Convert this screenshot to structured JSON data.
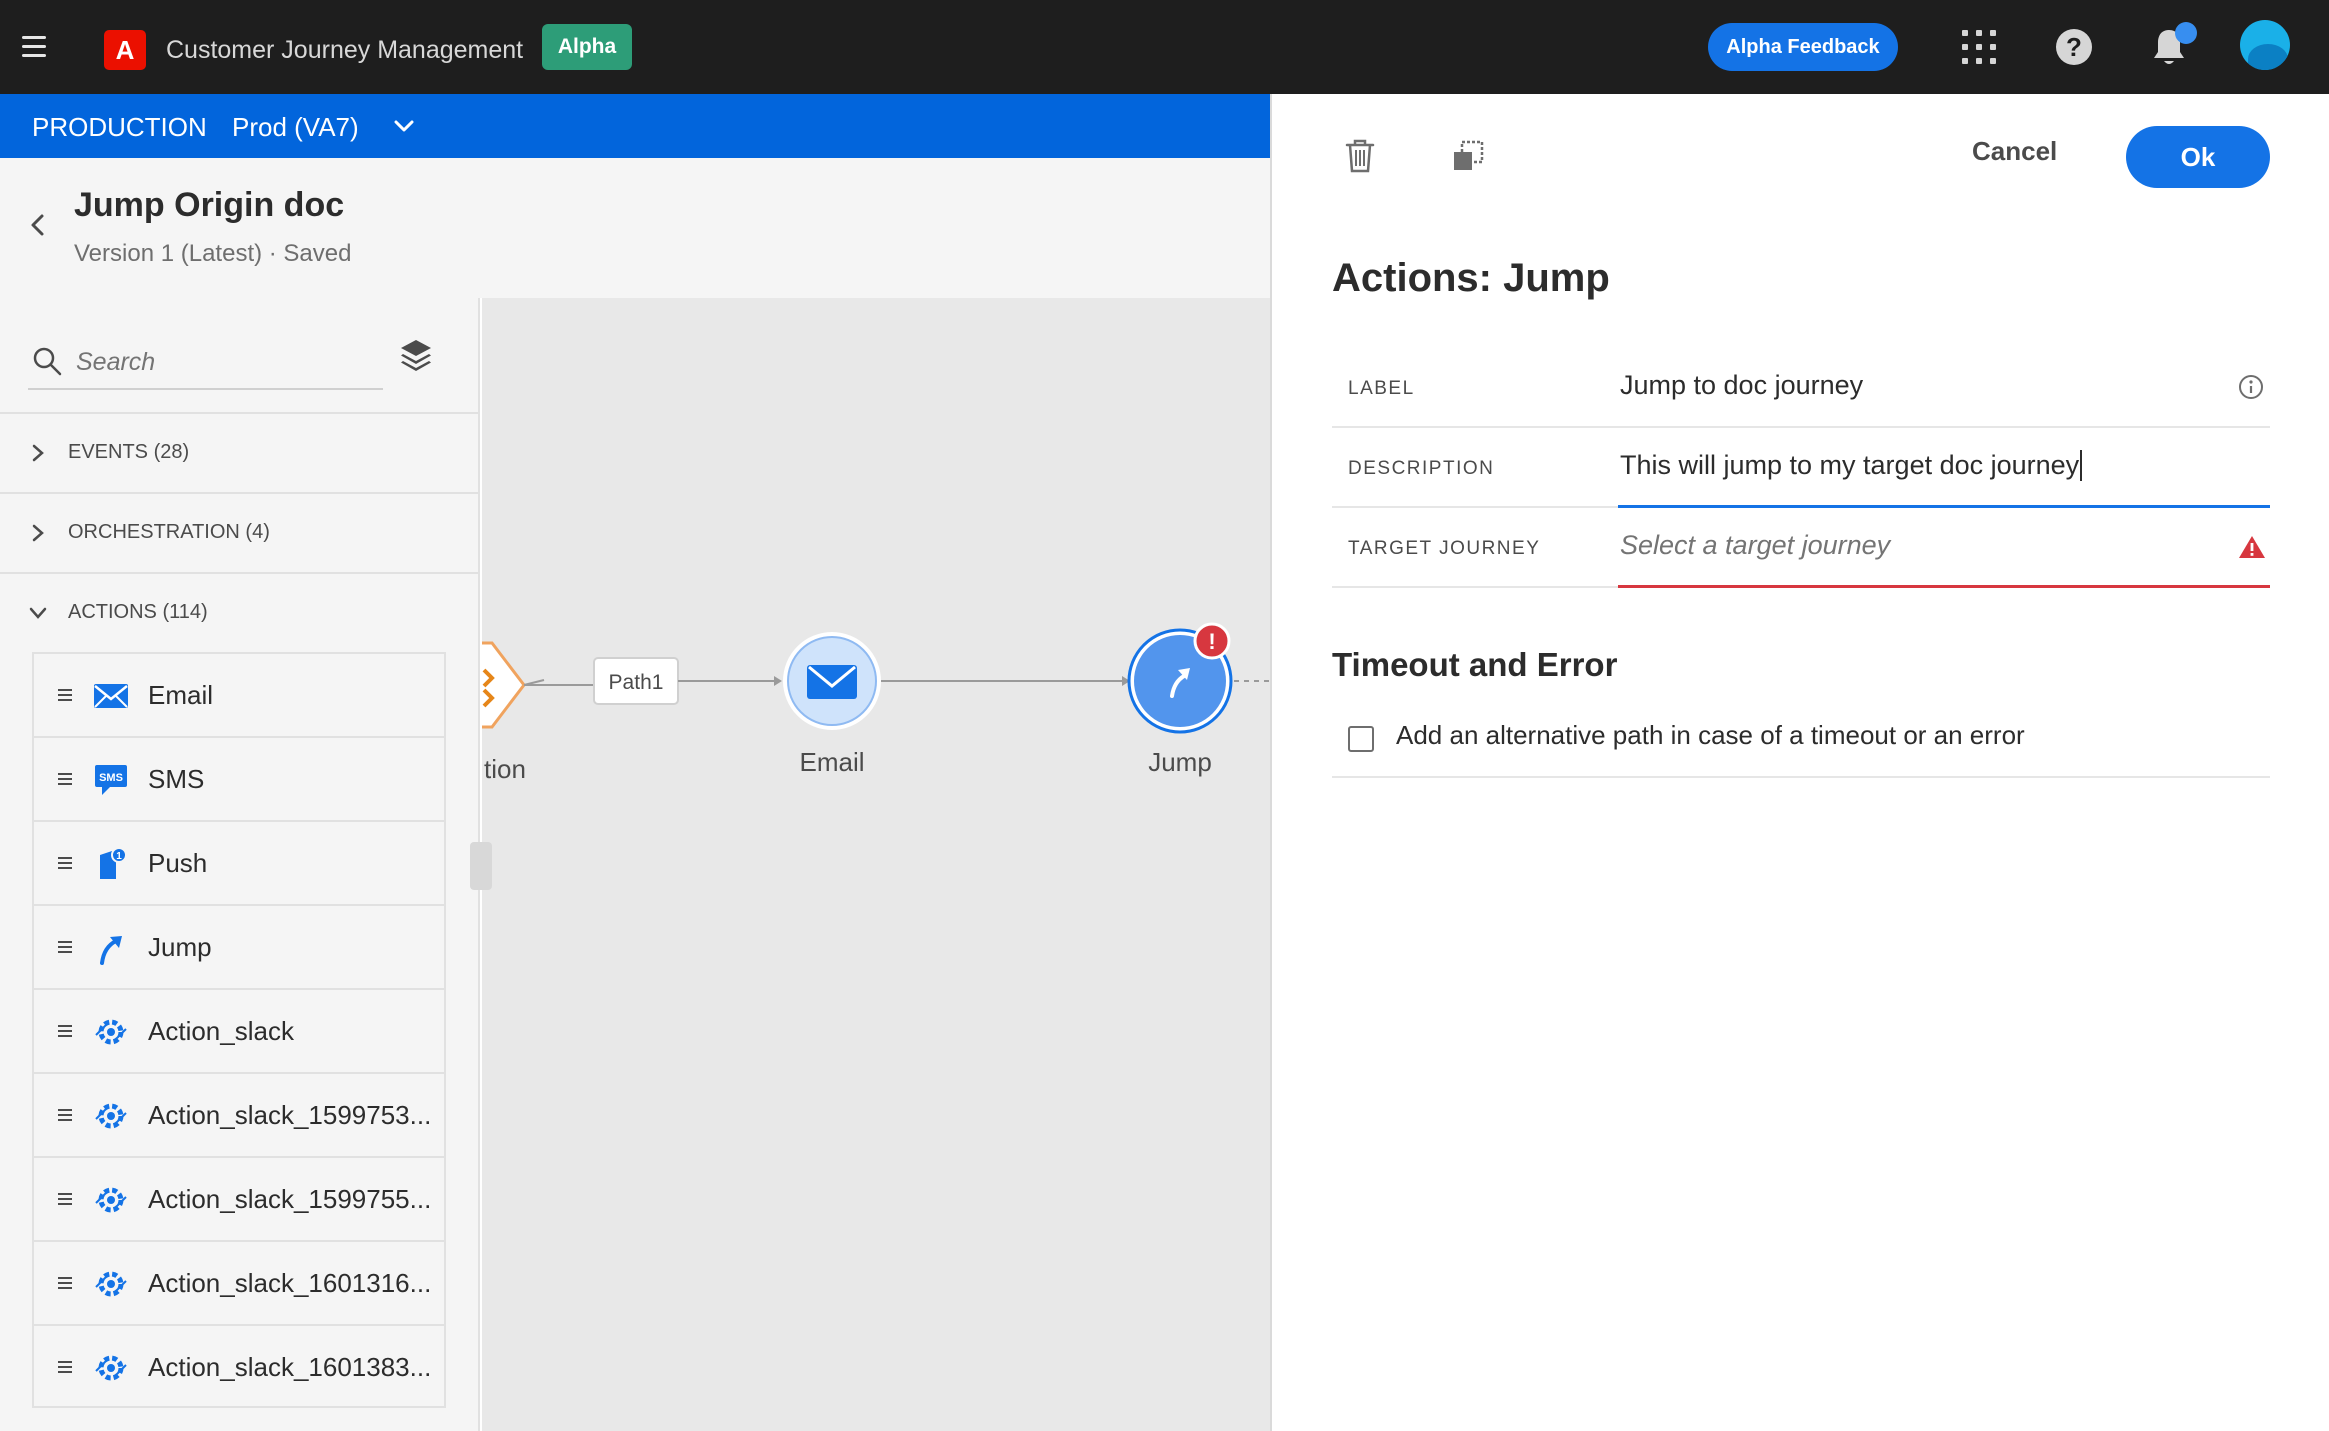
{
  "topbar": {
    "app_title": "Customer Journey Management",
    "alpha_badge": "Alpha",
    "feedback_label": "Alpha Feedback",
    "help_glyph": "?",
    "logo_glyph": "A",
    "icons": [
      "hamburger-icon",
      "adobe-logo",
      "app-grid-icon",
      "help-icon",
      "bell-icon",
      "avatar"
    ]
  },
  "envbar": {
    "sandbox_label": "PRODUCTION",
    "sandbox_value": "Prod (VA7)"
  },
  "journey": {
    "title": "Jump Origin doc",
    "version": "Version 1 (Latest) · Saved"
  },
  "left_panel": {
    "search_placeholder": "Search",
    "categories": [
      {
        "label": "EVENTS (28)",
        "expanded": false
      },
      {
        "label": "ORCHESTRATION (4)",
        "expanded": false
      },
      {
        "label": "ACTIONS (114)",
        "expanded": true
      }
    ],
    "actions": [
      {
        "label": "Email",
        "icon": "email-icon"
      },
      {
        "label": "SMS",
        "icon": "sms-icon"
      },
      {
        "label": "Push",
        "icon": "push-icon"
      },
      {
        "label": "Jump",
        "icon": "jump-icon"
      },
      {
        "label": "Action_slack",
        "icon": "custom-action-icon"
      },
      {
        "label": "Action_slack_1599753...",
        "icon": "custom-action-icon"
      },
      {
        "label": "Action_slack_1599755...",
        "icon": "custom-action-icon"
      },
      {
        "label": "Action_slack_1601316...",
        "icon": "custom-action-icon"
      },
      {
        "label": "Action_slack_1601383...",
        "icon": "custom-action-icon"
      }
    ]
  },
  "canvas": {
    "partial_node_label": "tion",
    "path_label": "Path1",
    "email_node_label": "Email",
    "jump_node_label": "Jump",
    "error_glyph": "!"
  },
  "right_panel": {
    "cancel_label": "Cancel",
    "ok_label": "Ok",
    "title": "Actions: Jump",
    "fields": {
      "label": {
        "name": "LABEL",
        "value": "Jump to doc journey"
      },
      "description": {
        "name": "DESCRIPTION",
        "value": "This will jump to my target doc journey"
      },
      "target": {
        "name": "TARGET JOURNEY",
        "placeholder": "Select a target journey"
      }
    },
    "timeout_title": "Timeout and Error",
    "timeout_checkbox_label": "Add an alternative path in case of a timeout or an error",
    "timeout_checked": false
  },
  "colors": {
    "topbar": "#1e1e1e",
    "env_blue": "#0265dc",
    "accent_blue": "#1473e6",
    "alpha_green": "#2d9d78",
    "error_red": "#d7373f",
    "warning_orange": "#e68619"
  }
}
